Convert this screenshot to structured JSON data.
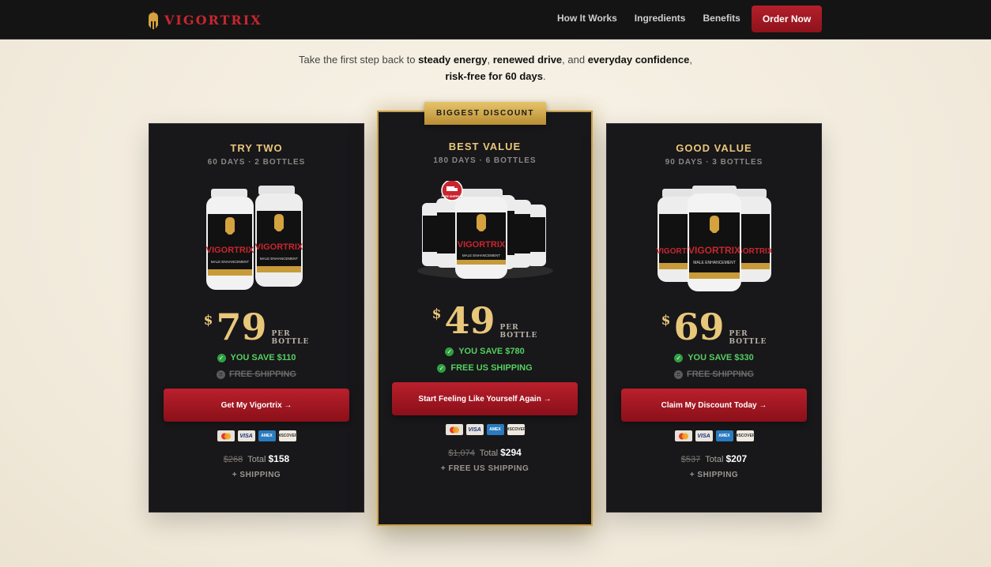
{
  "nav": {
    "brand": "VIGORTRIX",
    "links": [
      "How It Works",
      "Ingredients",
      "Benefits"
    ],
    "cta": "Order Now"
  },
  "intro": {
    "p1": "Take the first step back to ",
    "b1": "steady energy",
    "p2": ", ",
    "b2": "renewed drive",
    "p3": ", and ",
    "b3": "everyday confidence",
    "p4": ", ",
    "b4": "risk-free for 60 days",
    "p5": "."
  },
  "ribbon": "BIGGEST DISCOUNT",
  "plans": [
    {
      "title": "TRY TWO",
      "subtitle": "60 DAYS · 2 BOTTLES",
      "currency": "$",
      "price": "79",
      "per_line1": "PER",
      "per_line2": "BOTTLE",
      "savings": "YOU SAVE $110",
      "shipping": "FREE SHIPPING",
      "shipping_included": false,
      "cta": "Get My Vigortrix →",
      "old_total": "$268",
      "total_label": "Total",
      "total": "$158",
      "ship_note": "+ SHIPPING"
    },
    {
      "title": "BEST VALUE",
      "subtitle": "180 DAYS · 6 BOTTLES",
      "currency": "$",
      "price": "49",
      "per_line1": "PER",
      "per_line2": "BOTTLE",
      "savings": "YOU SAVE $780",
      "shipping": "FREE US SHIPPING",
      "shipping_included": true,
      "cta": "Start Feeling Like Yourself Again →",
      "old_total": "$1,074",
      "total_label": "Total",
      "total": "$294",
      "ship_note": "+ FREE US SHIPPING"
    },
    {
      "title": "GOOD VALUE",
      "subtitle": "90 DAYS · 3 BOTTLES",
      "currency": "$",
      "price": "69",
      "per_line1": "PER",
      "per_line2": "BOTTLE",
      "savings": "YOU SAVE $330",
      "shipping": "FREE SHIPPING",
      "shipping_included": false,
      "cta": "Claim My Discount Today →",
      "old_total": "$537",
      "total_label": "Total",
      "total": "$207",
      "ship_note": "+ SHIPPING"
    }
  ],
  "payment_icons": [
    "mastercard-icon",
    "visa-icon",
    "amex-icon",
    "discover-icon"
  ],
  "payment_labels": {
    "visa": "VISA",
    "amex": "AMEX",
    "discover": "DISCOVER"
  },
  "bottle": {
    "brand": "VIGORTRIX",
    "tagline": "MALE ENHANCEMENT",
    "badge": "FREE SHIPPING"
  },
  "colors": {
    "accent_red": "#b3202b",
    "gold": "#e8c77a",
    "success_green": "#54d05f",
    "card_bg": "#18171a"
  }
}
